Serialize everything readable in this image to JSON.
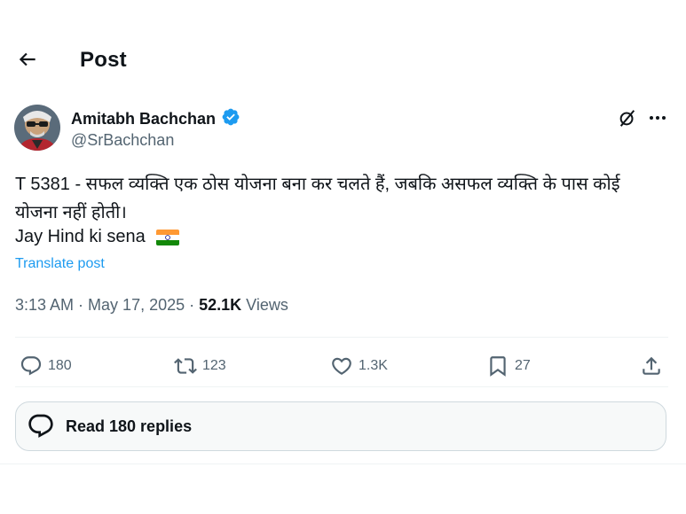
{
  "header": {
    "title": "Post"
  },
  "author": {
    "name": "Amitabh Bachchan",
    "handle": "@SrBachchan",
    "verified_color": "#1d9bf0"
  },
  "post": {
    "text": "T 5381 -  सफल व्यक्ति एक ठोस योजना बना कर चलते हैं, जबकि असफल व्यक्ति के पास कोई योजना नहीं होती।",
    "line2": "Jay Hind ki sena",
    "translate_label": "Translate post",
    "time": "3:13 AM",
    "sep": " · ",
    "date": "May 17, 2025",
    "views_count": "52.1K",
    "views_label": " Views"
  },
  "actions": {
    "replies": "180",
    "reposts": "123",
    "likes": "1.3K",
    "bookmarks": "27"
  },
  "read_replies": {
    "label": "Read 180 replies"
  },
  "icons": {
    "back": "arrow-left-icon",
    "verified": "verified-badge-icon",
    "grok": "grok-icon",
    "more": "more-icon",
    "reply": "reply-icon",
    "repost": "repost-icon",
    "like": "heart-icon",
    "bookmark": "bookmark-icon",
    "share": "share-icon",
    "flag": "india-flag-icon",
    "conversation": "conversation-icon"
  },
  "colors": {
    "link": "#1d9bf0",
    "muted": "#536471",
    "text": "#0f1419"
  }
}
